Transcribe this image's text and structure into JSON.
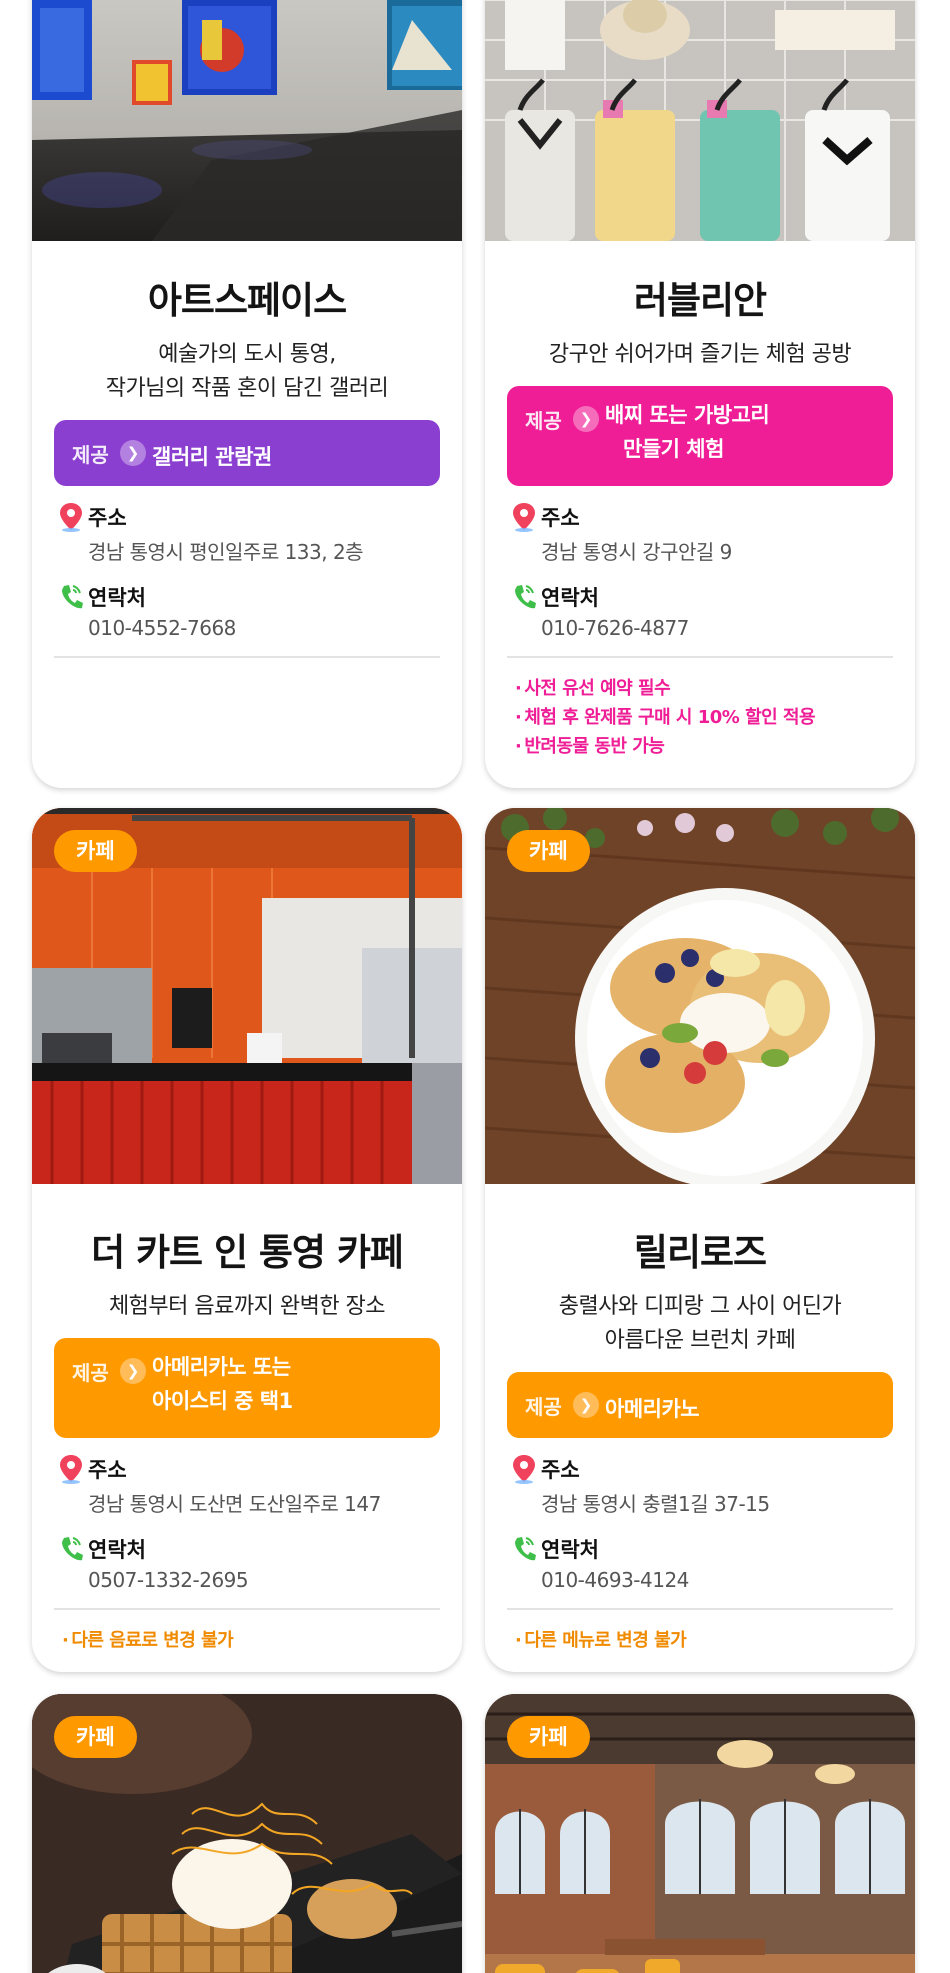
{
  "cards": [
    {
      "name": "아트스페이스",
      "desc1": "예술가의 도시 통영,",
      "desc2": "작가님의 작품 혼이 담긴 갤러리",
      "provide_tag": "제공",
      "provide1": "갤러리 관람권",
      "address_label": "주소",
      "address": "경남 통영시 평인일주로 133, 2층",
      "contact_label": "연락처",
      "contact": "010-4552-7668"
    },
    {
      "name": "러블리안",
      "desc1": "강구안 쉬어가며 즐기는 체험 공방",
      "provide_tag": "제공",
      "provide1": "배찌 또는 가방고리",
      "provide2": "만들기 체험",
      "address_label": "주소",
      "address": "경남 통영시 강구안길 9",
      "contact_label": "연락처",
      "contact": "010-7626-4877",
      "notes": [
        "사전 유선 예약 필수",
        "체험 후 완제품 구매 시 10% 할인 적용",
        "반려동물 동반 가능"
      ]
    },
    {
      "badge": "카페",
      "name": "더 카트 인 통영 카페",
      "desc1": "체험부터 음료까지 완벽한 장소",
      "provide_tag": "제공",
      "provide1": "아메리카노 또는",
      "provide2": "아이스티 중 택1",
      "address_label": "주소",
      "address": "경남 통영시 도산면 도산일주로 147",
      "contact_label": "연락처",
      "contact": "0507-1332-2695",
      "notes": [
        "다른 음료로 변경 불가"
      ]
    },
    {
      "badge": "카페",
      "name": "릴리로즈",
      "desc1": "충렬사와 디피랑 그 사이 어딘가",
      "desc2": "아름다운 브런치 카페",
      "provide_tag": "제공",
      "provide1": "아메리카노",
      "address_label": "주소",
      "address": "경남 통영시 충렬1길 37-15",
      "contact_label": "연락처",
      "contact": "010-4693-4124",
      "notes": [
        "다른 메뉴로 변경 불가"
      ]
    },
    {
      "badge": "카페"
    },
    {
      "badge": "카페"
    }
  ],
  "colors": {
    "purple": "#8b3fd0",
    "pink": "#ef1e96",
    "orange": "#ff9900"
  }
}
